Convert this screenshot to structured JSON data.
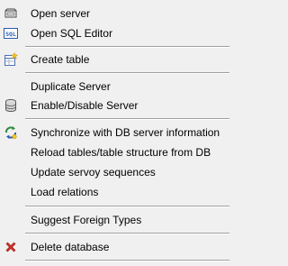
{
  "menu": {
    "items": [
      {
        "label": "Open server",
        "icon": "open-server-icon"
      },
      {
        "label": "Open SQL Editor",
        "icon": "sql-editor-icon"
      },
      {
        "label": "Create table",
        "icon": "create-table-icon"
      },
      {
        "label": "Duplicate Server",
        "icon": ""
      },
      {
        "label": "Enable/Disable Server",
        "icon": "database-icon"
      },
      {
        "label": "Synchronize with DB server information",
        "icon": "synchronize-icon"
      },
      {
        "label": "Reload tables/table structure from DB",
        "icon": ""
      },
      {
        "label": "Update servoy sequences",
        "icon": ""
      },
      {
        "label": "Load relations",
        "icon": ""
      },
      {
        "label": "Suggest Foreign Types",
        "icon": ""
      },
      {
        "label": "Delete database",
        "icon": "delete-icon"
      }
    ]
  },
  "colors": {
    "background": "#f0f0f0",
    "separator": "#a0a0a0",
    "delete_red": "#d9302a",
    "sql_blue": "#2a5db0"
  }
}
